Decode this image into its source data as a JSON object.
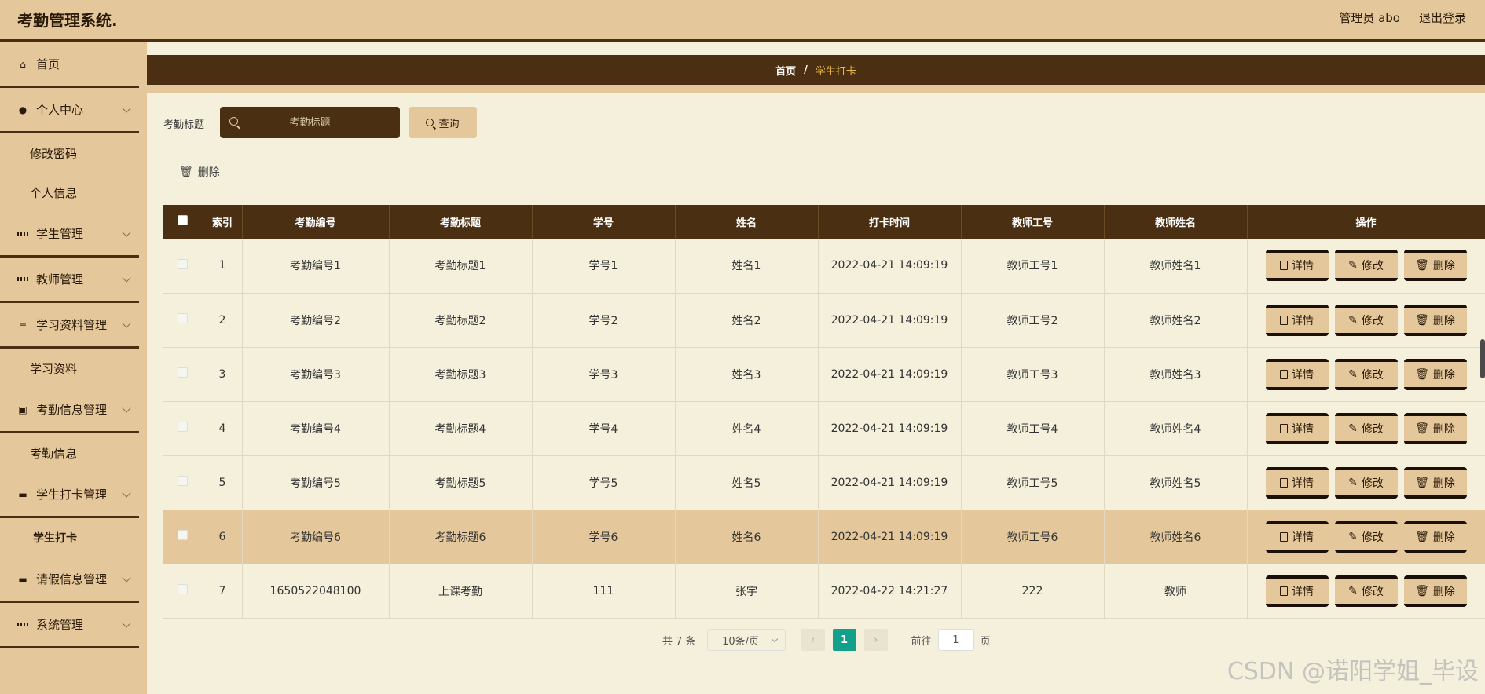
{
  "header": {
    "app_title": "考勤管理系统.",
    "user": "管理员 abo",
    "logout": "退出登录"
  },
  "sidebar": {
    "items": [
      {
        "label": "首页",
        "icon": "home-icon"
      },
      {
        "label": "个人中心",
        "icon": "user-icon"
      },
      {
        "label": "修改密码"
      },
      {
        "label": "个人信息"
      },
      {
        "label": "学生管理",
        "icon": "grid-icon"
      },
      {
        "label": "教师管理",
        "icon": "grid-icon"
      },
      {
        "label": "学习资料管理",
        "icon": "sliders-icon"
      },
      {
        "label": "学习资料"
      },
      {
        "label": "考勤信息管理",
        "icon": "clipboard-icon"
      },
      {
        "label": "考勤信息"
      },
      {
        "label": "学生打卡管理",
        "icon": "briefcase-icon"
      },
      {
        "label": "学生打卡"
      },
      {
        "label": "请假信息管理",
        "icon": "briefcase-icon"
      },
      {
        "label": "系统管理",
        "icon": "grid-icon"
      }
    ]
  },
  "breadcrumb": {
    "home": "首页",
    "separator": "/",
    "current": "学生打卡"
  },
  "search": {
    "label": "考勤标题",
    "placeholder": "考勤标题",
    "query_button": "查询"
  },
  "toolbar": {
    "delete_label": "删除"
  },
  "table": {
    "headers": [
      "索引",
      "考勤编号",
      "考勤标题",
      "学号",
      "姓名",
      "打卡时间",
      "教师工号",
      "教师姓名",
      "操作"
    ],
    "rows": [
      {
        "index": "1",
        "code": "考勤编号1",
        "title": "考勤标题1",
        "sid": "学号1",
        "name": "姓名1",
        "time": "2022-04-21 14:09:19",
        "tid": "教师工号1",
        "tname": "教师姓名1"
      },
      {
        "index": "2",
        "code": "考勤编号2",
        "title": "考勤标题2",
        "sid": "学号2",
        "name": "姓名2",
        "time": "2022-04-21 14:09:19",
        "tid": "教师工号2",
        "tname": "教师姓名2"
      },
      {
        "index": "3",
        "code": "考勤编号3",
        "title": "考勤标题3",
        "sid": "学号3",
        "name": "姓名3",
        "time": "2022-04-21 14:09:19",
        "tid": "教师工号3",
        "tname": "教师姓名3"
      },
      {
        "index": "4",
        "code": "考勤编号4",
        "title": "考勤标题4",
        "sid": "学号4",
        "name": "姓名4",
        "time": "2022-04-21 14:09:19",
        "tid": "教师工号4",
        "tname": "教师姓名4"
      },
      {
        "index": "5",
        "code": "考勤编号5",
        "title": "考勤标题5",
        "sid": "学号5",
        "name": "姓名5",
        "time": "2022-04-21 14:09:19",
        "tid": "教师工号5",
        "tname": "教师姓名5"
      },
      {
        "index": "6",
        "code": "考勤编号6",
        "title": "考勤标题6",
        "sid": "学号6",
        "name": "姓名6",
        "time": "2022-04-21 14:09:19",
        "tid": "教师工号6",
        "tname": "教师姓名6"
      },
      {
        "index": "7",
        "code": "1650522048100",
        "title": "上课考勤",
        "sid": "111",
        "name": "张宇",
        "time": "2022-04-22 14:21:27",
        "tid": "222",
        "tname": "教师"
      }
    ],
    "highlighted_row": 6,
    "actions": {
      "detail": "详情",
      "edit": "修改",
      "delete": "删除"
    }
  },
  "pagination": {
    "total": "共 7 条",
    "page_size": "10条/页",
    "current_page": "1",
    "goto_prefix": "前往",
    "goto_value": "1",
    "goto_suffix": "页"
  },
  "watermark": "CSDN @诺阳学姐_毕设",
  "colors": {
    "primary_dark": "#4a2f12",
    "primary_light": "#e4c89c",
    "background": "#f4f0dc",
    "accent_active": "#13a08a",
    "breadcrumb_current": "#e8b84a"
  }
}
